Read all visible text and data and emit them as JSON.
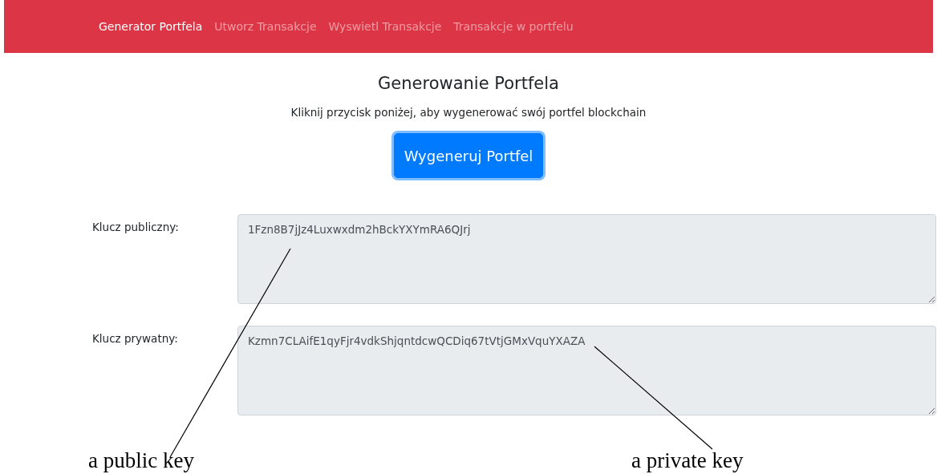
{
  "navbar": {
    "items": [
      {
        "label": "Generator Portfela",
        "selected": true
      },
      {
        "label": "Utworz Transakcje",
        "selected": false
      },
      {
        "label": "Wyswietl Transakcje",
        "selected": false
      },
      {
        "label": "Transakcje w portfelu",
        "selected": false
      }
    ]
  },
  "heading": "Generowanie Portfela",
  "subtitle": "Kliknij przycisk poniżej, aby wygenerować swój portfel blockchain",
  "button": "Wygeneruj Portfel",
  "fields": [
    {
      "label": "Klucz publiczny:",
      "value": "1Fzn8B7jJz4Luxwxdm2hBckYXYmRA6QJrj"
    },
    {
      "label": "Klucz prywatny:",
      "value": "Kzmn7CLAifE1qyFjr4vdkShjqntdcwQCDiq67tVtjGMxVquYXAZA"
    }
  ],
  "annotations": [
    "a public key",
    "a private key"
  ]
}
